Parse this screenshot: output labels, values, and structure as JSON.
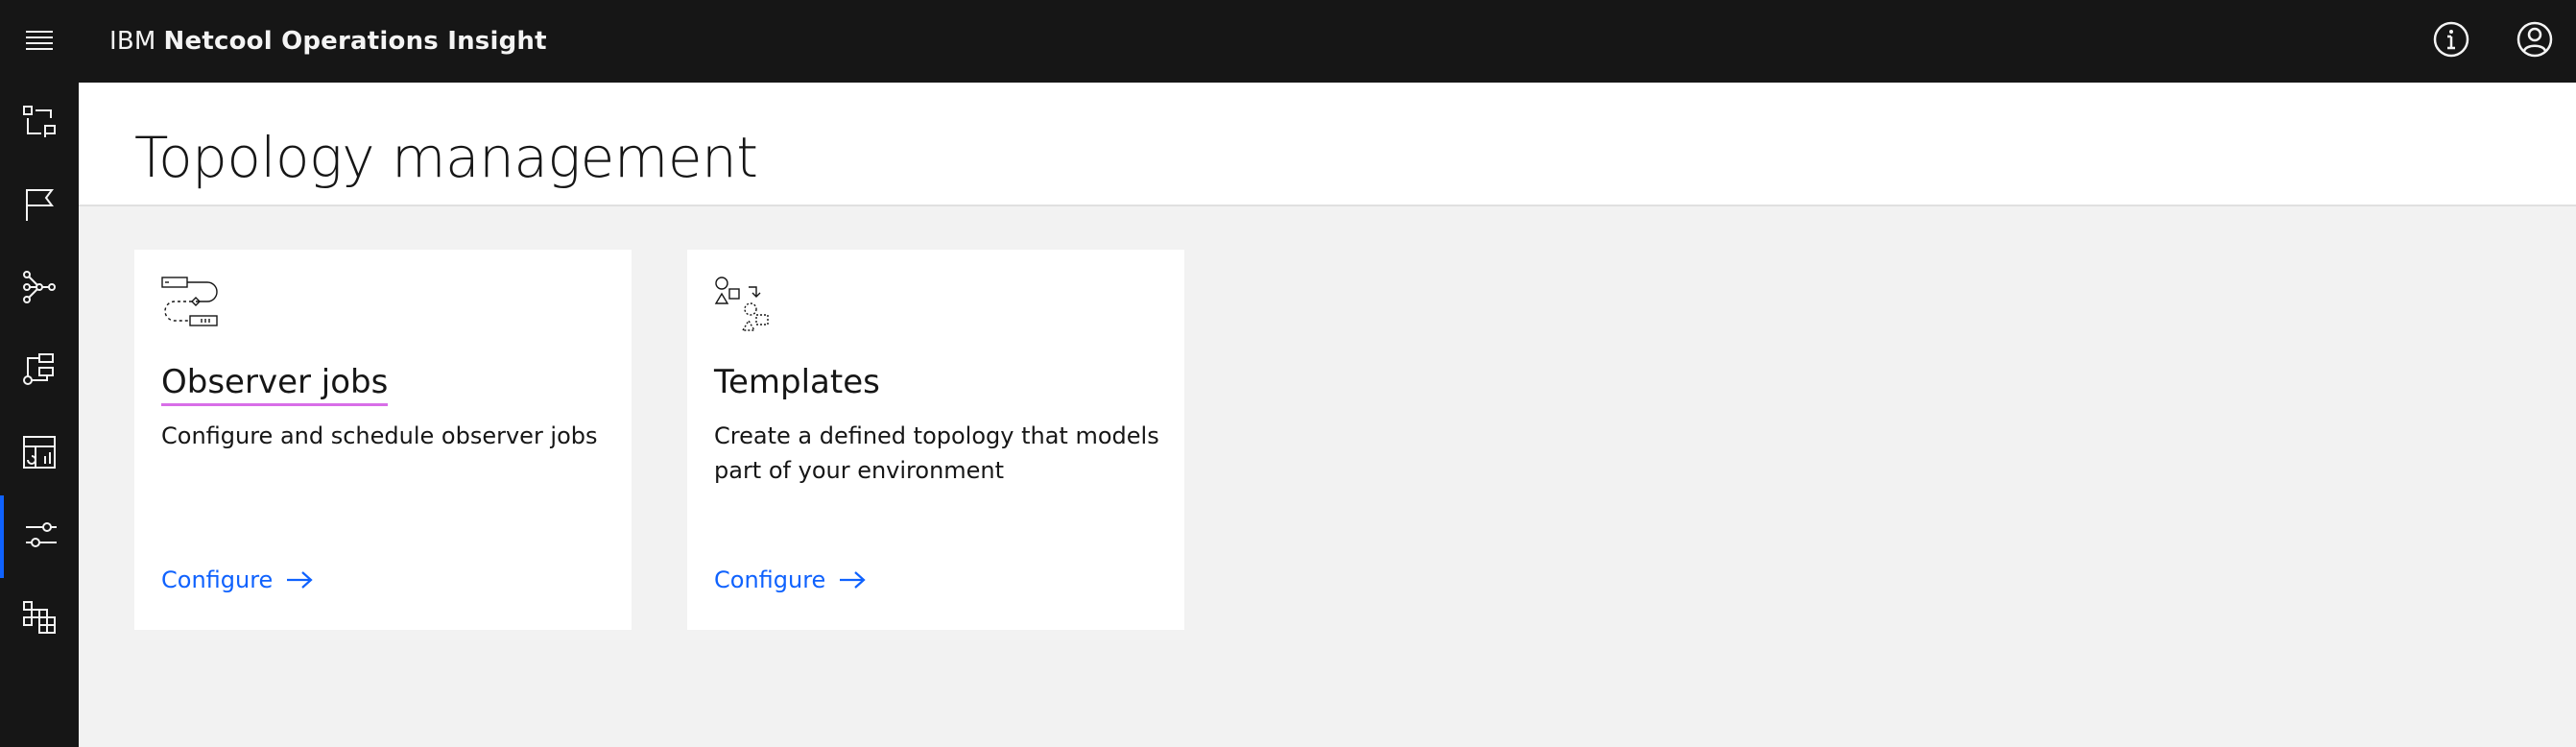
{
  "header": {
    "title_prefix": "IBM",
    "title_product": "Netcool Operations Insight",
    "icons": [
      "menu-icon",
      "info-icon",
      "user-avatar-icon"
    ]
  },
  "sidenav": {
    "items": [
      {
        "icon": "events-icon"
      },
      {
        "icon": "flag-icon"
      },
      {
        "icon": "topology-network-icon"
      },
      {
        "icon": "workflow-icon"
      },
      {
        "icon": "dashboard-icon"
      },
      {
        "icon": "settings-adjust-icon",
        "active": true
      },
      {
        "icon": "applications-grid-icon"
      }
    ]
  },
  "page": {
    "title": "Topology management"
  },
  "cards": [
    {
      "title": "Observer jobs",
      "description": "Configure and schedule observer jobs",
      "link_label": "Configure",
      "pictogram": "observer-jobs-pictogram"
    },
    {
      "title": "Templates",
      "description": "Create a defined topology that models part of your environment",
      "link_label": "Configure",
      "pictogram": "templates-pictogram"
    }
  ],
  "colors": {
    "header_bg": "#161616",
    "page_bg": "#f2f2f2",
    "link": "#0f62fe",
    "active_indicator": "#0f62fe",
    "title_underline": "#d86ee8"
  }
}
